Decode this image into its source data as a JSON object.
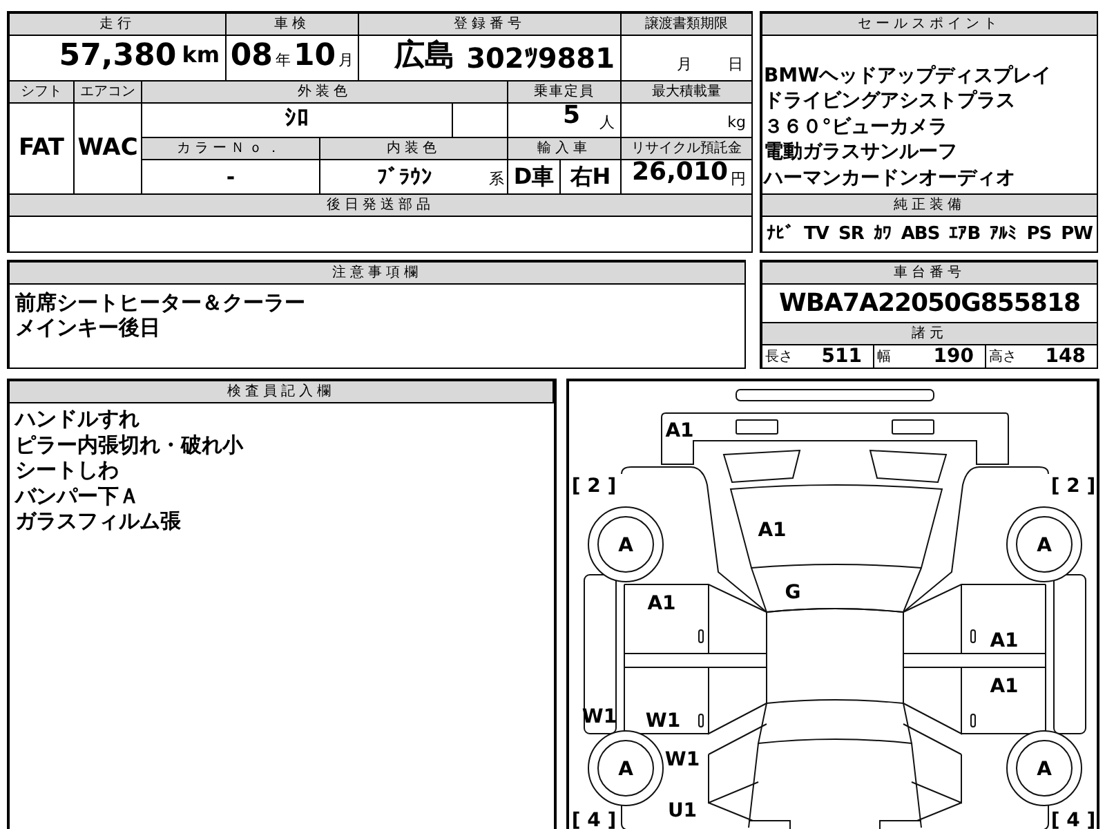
{
  "mileage": {
    "label": "走行",
    "value": "57,380",
    "unit": "km"
  },
  "inspection": {
    "label": "車検",
    "year": "08",
    "year_unit": "年",
    "month": "10",
    "month_unit": "月"
  },
  "registration": {
    "label": "登録番号",
    "region": "広島",
    "number": "302ﾂ9881"
  },
  "transfer_deadline": {
    "label": "譲渡書類期限",
    "month_unit": "月",
    "day_unit": "日"
  },
  "shift": {
    "label": "シフト",
    "value": "FAT"
  },
  "aircon": {
    "label": "エアコン",
    "value": "WAC"
  },
  "exterior_color": {
    "label": "外装色",
    "value": "ｼﾛ"
  },
  "capacity": {
    "label": "乗車定員",
    "value": "5",
    "unit": "人"
  },
  "max_load": {
    "label": "最大積載量",
    "unit": "kg"
  },
  "color_no": {
    "label": "カラーＮｏ．",
    "value": "-"
  },
  "interior_color": {
    "label": "内装色",
    "value": "ﾌﾞﾗｳﾝ",
    "suffix": "系"
  },
  "import": {
    "label": "輸入車",
    "dealer": "D車",
    "steering": "右H"
  },
  "recycling_fee": {
    "label": "リサイクル預託金",
    "value": "26,010",
    "unit": "円"
  },
  "later_parts": {
    "label": "後日発送部品"
  },
  "sales_points": {
    "label": "セールスポイント",
    "lines": [
      "BMWヘッドアップディスプレイ",
      "ドライビングアシストプラス",
      "３６０°ビューカメラ",
      "電動ガラスサンルーフ",
      "ハーマンカードンオーディオ"
    ]
  },
  "equipment": {
    "label": "純正装備",
    "items": [
      "ﾅﾋﾞ",
      "TV",
      "SR",
      "ｶﾜ",
      "ABS",
      "ｴｱB",
      "ｱﾙﾐ",
      "PS",
      "PW"
    ]
  },
  "notes": {
    "label": "注意事項欄",
    "lines": [
      "前席シートヒーター＆クーラー",
      "メインキー後日"
    ]
  },
  "chassis": {
    "label": "車台番号",
    "value": "WBA7A22050G855818"
  },
  "specs": {
    "label": "諸元",
    "items": [
      {
        "label": "長さ",
        "value": "511"
      },
      {
        "label": "幅",
        "value": "190"
      },
      {
        "label": "高さ",
        "value": "148"
      }
    ]
  },
  "inspector_notes": {
    "label": "検査員記入欄",
    "lines": [
      "ハンドルすれ",
      "ピラー内張切れ・破れ小",
      "シートしわ",
      "バンパー下Ａ",
      "ガラスフィルム張"
    ]
  },
  "damage_marks": [
    "A1",
    "[ 2 ]",
    "[ 2 ]",
    "A",
    "A1",
    "A",
    "G",
    "A1",
    "A1",
    "A1",
    "W1",
    "W1",
    "W1",
    "A",
    "A",
    "U1",
    "[ 4 ]",
    "[ 4 ]"
  ]
}
